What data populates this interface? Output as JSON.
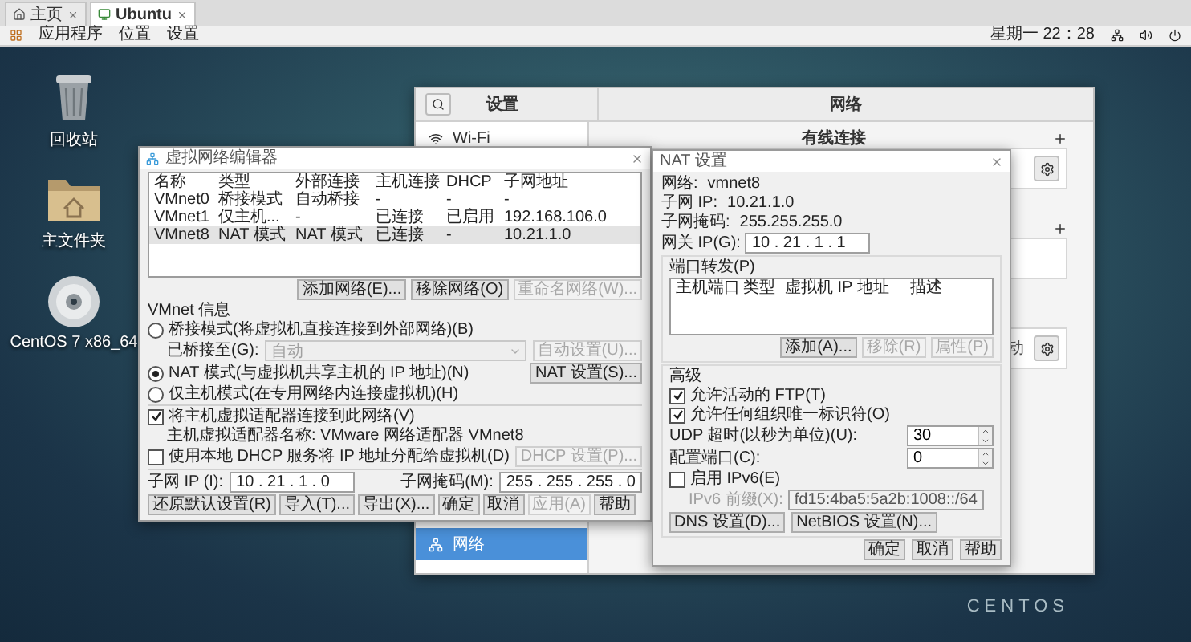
{
  "browser_tabs": [
    {
      "label": "主页",
      "kind": "home",
      "selected": false
    },
    {
      "label": "Ubuntu",
      "kind": "vm",
      "selected": true
    }
  ],
  "top_bar": {
    "menus": [
      "应用程序",
      "位置",
      "设置"
    ],
    "clock": "星期一 22：28"
  },
  "desktop": {
    "icons": [
      {
        "kind": "trash",
        "label": "回收站"
      },
      {
        "kind": "folder",
        "label": "主文件夹"
      },
      {
        "kind": "disc",
        "label": "CentOS 7 x86_64"
      }
    ],
    "wallpaper_text": "CENTOS"
  },
  "settings_window": {
    "title": "设置",
    "panel_title": "网络",
    "sidebar": [
      {
        "kind": "wifi",
        "label": "Wi-Fi",
        "selected": false
      },
      {
        "kind": "network",
        "label": "网络",
        "selected": true
      }
    ],
    "sections": [
      {
        "title": "有线连接",
        "add_button": true,
        "cards": [
          {
            "settings_button": true
          }
        ]
      },
      {
        "add_button": true,
        "cards": [
          {
            "settings_button": false
          }
        ]
      },
      {
        "add_button": false,
        "cards": [
          {
            "status": "动",
            "settings_button": true
          }
        ]
      }
    ]
  },
  "vmnet_editor": {
    "title": "虚拟网络编辑器",
    "columns": [
      "名称",
      "类型",
      "外部连接",
      "主机连接",
      "DHCP",
      "子网地址"
    ],
    "rows": [
      {
        "cells": [
          "VMnet0",
          "桥接模式",
          "自动桥接",
          "-",
          "-",
          "-"
        ],
        "selected": false
      },
      {
        "cells": [
          "VMnet1",
          "仅主机...",
          "-",
          "已连接",
          "已启用",
          "192.168.106.0"
        ],
        "selected": false
      },
      {
        "cells": [
          "VMnet8",
          "NAT 模式",
          "NAT 模式",
          "已连接",
          "-",
          "10.21.1.0"
        ],
        "selected": true
      }
    ],
    "table_buttons": [
      {
        "label": "添加网络(E)...",
        "disabled": false
      },
      {
        "label": "移除网络(O)",
        "disabled": false
      },
      {
        "label": "重命名网络(W)...",
        "disabled": true
      }
    ],
    "info_title": "VMnet 信息",
    "modes": [
      {
        "label": "桥接模式(将虚拟机直接连接到外部网络)(B)",
        "selected": false
      },
      {
        "label": "NAT 模式(与虚拟机共享主机的 IP 地址)(N)",
        "selected": true
      },
      {
        "label": "仅主机模式(在专用网络内连接虚拟机)(H)",
        "selected": false
      }
    ],
    "bridged_to": {
      "label": "已桥接至(G):",
      "value": "自动",
      "disabled": true,
      "button": {
        "label": "自动设置(U)...",
        "disabled": true
      }
    },
    "nat_button": {
      "label": "NAT 设置(S)...",
      "disabled": false
    },
    "connect_adapter": {
      "label": "将主机虚拟适配器连接到此网络(V)",
      "checked": true
    },
    "adapter_name": "主机虚拟适配器名称: VMware 网络适配器 VMnet8",
    "use_dhcp": {
      "label": "使用本地 DHCP 服务将 IP 地址分配给虚拟机(D)",
      "checked": false
    },
    "dhcp_button": {
      "label": "DHCP 设置(P)...",
      "disabled": true
    },
    "subnet_ip": {
      "label": "子网 IP (I):",
      "value": "10 . 21 . 1 . 0"
    },
    "subnet_mask": {
      "label": "子网掩码(M):",
      "value": "255 . 255 . 255 . 0"
    },
    "footer_buttons": [
      {
        "label": "还原默认设置(R)",
        "disabled": false
      },
      {
        "label": "导入(T)...",
        "disabled": false
      },
      {
        "label": "导出(X)...",
        "disabled": false
      },
      {
        "label": "确定",
        "disabled": false
      },
      {
        "label": "取消",
        "disabled": false
      },
      {
        "label": "应用(A)",
        "disabled": true
      },
      {
        "label": "帮助",
        "disabled": false
      }
    ]
  },
  "nat_settings": {
    "title": "NAT 设置",
    "info": [
      {
        "label": "网络:",
        "value": "vmnet8"
      },
      {
        "label": "子网 IP:",
        "value": "10.21.1.0"
      },
      {
        "label": "子网掩码:",
        "value": "255.255.255.0"
      }
    ],
    "gateway": {
      "label": "网关 IP(G):",
      "value": "10 . 21 . 1 . 1"
    },
    "port_forwarding": {
      "title": "端口转发(P)",
      "columns": [
        "主机端口",
        "类型",
        "虚拟机 IP 地址",
        "描述"
      ],
      "buttons": [
        {
          "label": "添加(A)...",
          "disabled": false
        },
        {
          "label": "移除(R)",
          "disabled": true
        },
        {
          "label": "属性(P)",
          "disabled": true
        }
      ]
    },
    "advanced": {
      "title": "高级",
      "checkboxes": [
        {
          "label": "允许活动的 FTP(T)",
          "checked": true
        },
        {
          "label": "允许任何组织唯一标识符(O)",
          "checked": true
        }
      ],
      "spinners": [
        {
          "label": "UDP 超时(以秒为单位)(U):",
          "value": "30"
        },
        {
          "label": "配置端口(C):",
          "value": "0"
        }
      ],
      "ipv6": {
        "label": "启用 IPv6(E)",
        "checked": false
      },
      "ipv6_prefix": {
        "label": "IPv6 前缀(X):",
        "value": "fd15:4ba5:5a2b:1008::/64",
        "disabled": true
      },
      "buttons": [
        {
          "label": "DNS 设置(D)...",
          "disabled": false
        },
        {
          "label": "NetBIOS 设置(N)...",
          "disabled": false
        }
      ]
    },
    "footer_buttons": [
      {
        "label": "确定",
        "disabled": false
      },
      {
        "label": "取消",
        "disabled": false
      },
      {
        "label": "帮助",
        "disabled": false
      }
    ]
  }
}
